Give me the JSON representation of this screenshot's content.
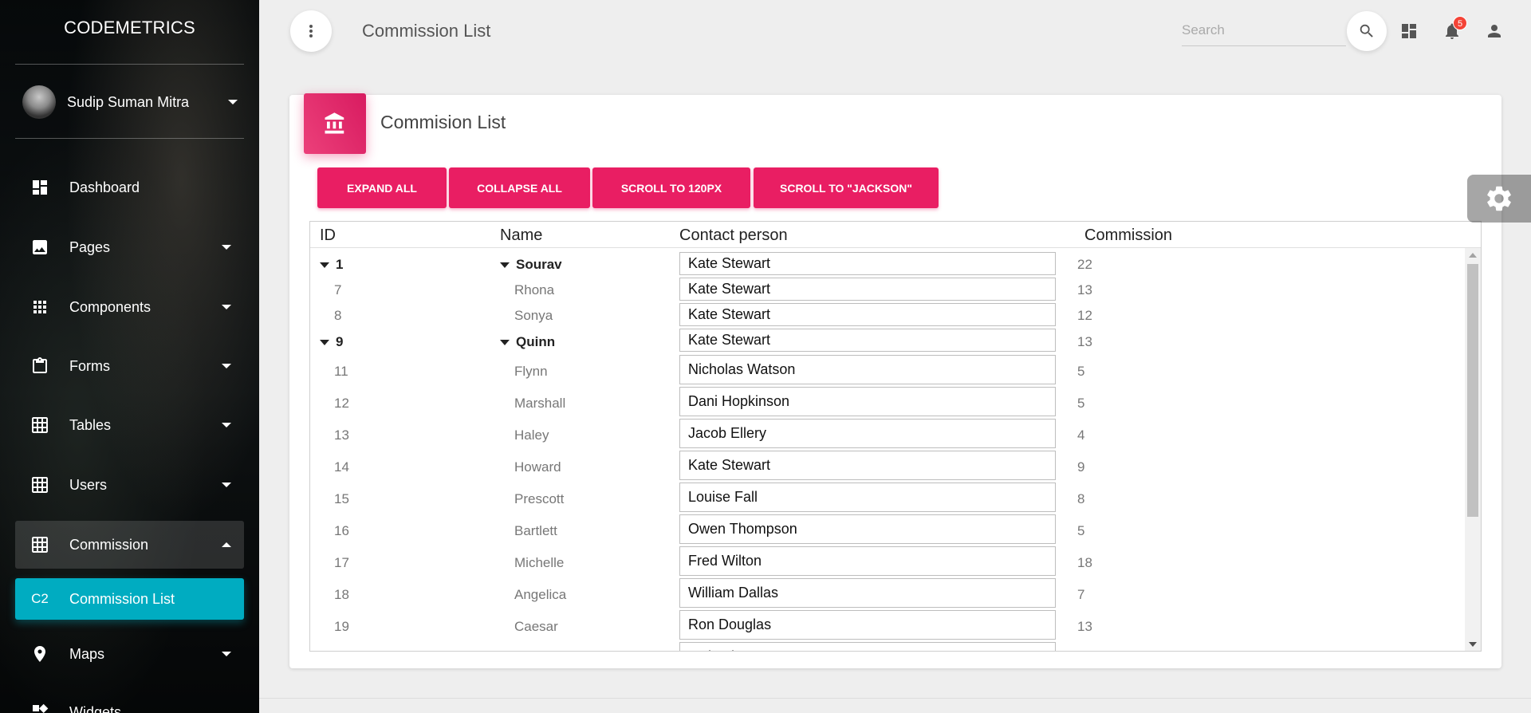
{
  "app": {
    "brand": "CODEMETRICS",
    "page_title": "Commission List"
  },
  "sidebar": {
    "user_name": "Sudip Suman Mitra",
    "items": [
      {
        "label": "Dashboard",
        "icon": "dashboard-icon"
      },
      {
        "label": "Pages",
        "icon": "image-icon"
      },
      {
        "label": "Components",
        "icon": "apps-icon"
      },
      {
        "label": "Forms",
        "icon": "clipboard-icon"
      },
      {
        "label": "Tables",
        "icon": "grid-icon"
      },
      {
        "label": "Users",
        "icon": "grid-icon"
      },
      {
        "label": "Commission",
        "icon": "grid-icon"
      },
      {
        "label": "Commission List",
        "abbr": "C2"
      },
      {
        "label": "Maps",
        "icon": "map-pin-icon"
      },
      {
        "label": "Widgets",
        "icon": "widgets-icon"
      }
    ]
  },
  "topbar": {
    "search_placeholder": "Search",
    "notification_count": "5"
  },
  "card": {
    "title": "Commision List",
    "buttons": {
      "expand": "EXPAND ALL",
      "collapse": "COLLAPSE ALL",
      "scroll_px": "SCROLL TO 120PX",
      "scroll_name": "SCROLL TO \"JACKSON\""
    }
  },
  "table": {
    "columns": {
      "id": "ID",
      "name": "Name",
      "contact": "Contact person",
      "commission": "Commission"
    },
    "rows": [
      {
        "id": "1",
        "name": "Sourav",
        "contact": "Kate Stewart",
        "commission": "22"
      },
      {
        "id": "7",
        "name": "Rhona",
        "contact": "Kate Stewart",
        "commission": "13"
      },
      {
        "id": "8",
        "name": "Sonya",
        "contact": "Kate Stewart",
        "commission": "12"
      },
      {
        "id": "9",
        "name": "Quinn",
        "contact": "Kate Stewart",
        "commission": "13"
      },
      {
        "id": "11",
        "name": "Flynn",
        "contact": "Nicholas Watson",
        "commission": "5"
      },
      {
        "id": "12",
        "name": "Marshall",
        "contact": "Dani Hopkinson",
        "commission": "5"
      },
      {
        "id": "13",
        "name": "Haley",
        "contact": "Jacob Ellery",
        "commission": "4"
      },
      {
        "id": "14",
        "name": "Howard",
        "contact": "Kate Stewart",
        "commission": "9"
      },
      {
        "id": "15",
        "name": "Prescott",
        "contact": "Louise Fall",
        "commission": "8"
      },
      {
        "id": "16",
        "name": "Bartlett",
        "contact": "Owen Thompson",
        "commission": "5"
      },
      {
        "id": "17",
        "name": "Michelle",
        "contact": "Fred Wilton",
        "commission": "18"
      },
      {
        "id": "18",
        "name": "Angelica",
        "contact": "William Dallas",
        "commission": "7"
      },
      {
        "id": "19",
        "name": "Caesar",
        "contact": "Ron Douglas",
        "commission": "13"
      },
      {
        "id": "",
        "name": "",
        "contact": "Mahesh Kumar",
        "commission": ""
      }
    ]
  }
}
